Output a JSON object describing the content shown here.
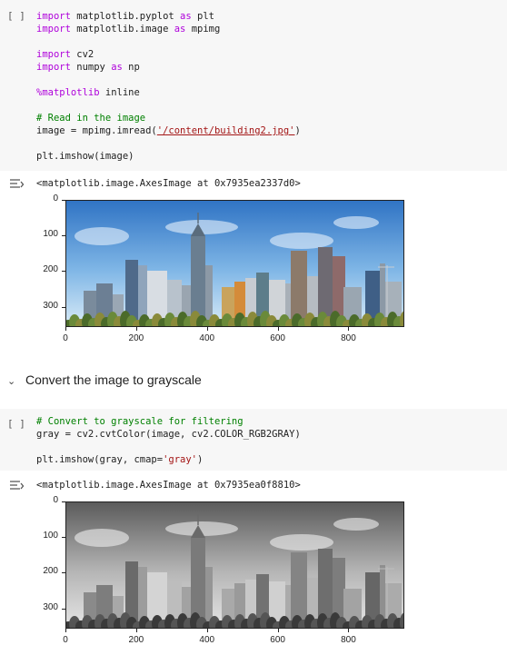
{
  "cell1": {
    "run_label": "[ ]",
    "lines": [
      [
        {
          "t": "import",
          "c": "kw"
        },
        {
          "t": " matplotlib.pyplot "
        },
        {
          "t": "as",
          "c": "kw"
        },
        {
          "t": " plt"
        }
      ],
      [
        {
          "t": "import",
          "c": "kw"
        },
        {
          "t": " matplotlib.image "
        },
        {
          "t": "as",
          "c": "kw"
        },
        {
          "t": " mpimg"
        }
      ],
      [],
      [
        {
          "t": "import",
          "c": "kw"
        },
        {
          "t": " cv2"
        }
      ],
      [
        {
          "t": "import",
          "c": "kw"
        },
        {
          "t": " numpy "
        },
        {
          "t": "as",
          "c": "kw"
        },
        {
          "t": " np"
        }
      ],
      [],
      [
        {
          "t": "%matplotlib",
          "c": "kw"
        },
        {
          "t": " inline"
        }
      ],
      [],
      [
        {
          "t": "# Read in the image",
          "c": "cm"
        }
      ],
      [
        {
          "t": "image = mpimg.imread("
        },
        {
          "t": "'/content/building2.jpg'",
          "c": "lnk"
        },
        {
          "t": ")"
        }
      ],
      [],
      [
        {
          "t": "plt.imshow(image)"
        }
      ]
    ]
  },
  "output1": {
    "text": "<matplotlib.image.AxesImage at 0x7935ea2337d0>",
    "yticks": [
      "0",
      "100",
      "200",
      "300"
    ],
    "xticks": [
      "0",
      "200",
      "400",
      "600",
      "800"
    ],
    "mode": "color"
  },
  "section": {
    "chevron": "⌄",
    "title": "Convert the image to grayscale"
  },
  "cell2": {
    "run_label": "[ ]",
    "lines": [
      [
        {
          "t": "# Convert to grayscale for filtering",
          "c": "cm"
        }
      ],
      [
        {
          "t": "gray = cv2.cvtColor(image, cv2.COLOR_RGB2GRAY)"
        }
      ],
      [],
      [
        {
          "t": "plt.imshow(gray, cmap="
        },
        {
          "t": "'gray'",
          "c": "str"
        },
        {
          "t": ")"
        }
      ]
    ]
  },
  "output2": {
    "text": "<matplotlib.image.AxesImage at 0x7935ea0f8810>",
    "yticks": [
      "0",
      "100",
      "200",
      "300"
    ],
    "xticks": [
      "0",
      "200",
      "400",
      "600",
      "800"
    ],
    "mode": "gray"
  },
  "colors": {
    "cell_bg": "#f7f7f7",
    "keyword": "#af00db",
    "comment": "#008000",
    "string": "#a31515"
  }
}
